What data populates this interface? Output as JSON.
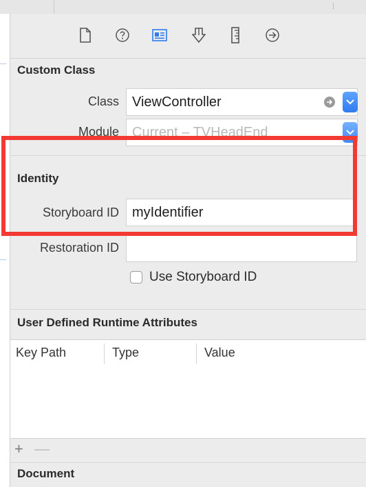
{
  "toolbar": {
    "tabs": [
      {
        "name": "file-inspector",
        "icon": "file-icon"
      },
      {
        "name": "quick-help",
        "icon": "question-circle-icon"
      },
      {
        "name": "identity-inspector",
        "icon": "identity-card-icon",
        "active": true
      },
      {
        "name": "attributes-inspector",
        "icon": "attributes-icon"
      },
      {
        "name": "size-inspector",
        "icon": "ruler-icon"
      },
      {
        "name": "connections-inspector",
        "icon": "arrow-circle-icon"
      }
    ],
    "active_color": "#2f7bef"
  },
  "custom_class": {
    "title": "Custom Class",
    "class_label": "Class",
    "class_value": "ViewController",
    "module_label": "Module",
    "module_value": "Current – TVHeadEnd"
  },
  "identity": {
    "title": "Identity",
    "storyboard_id_label": "Storyboard ID",
    "storyboard_id_value": "myIdentifier",
    "restoration_id_label": "Restoration ID",
    "restoration_id_value": "",
    "use_storyboard_id_label": "Use Storyboard ID",
    "use_storyboard_id_checked": false
  },
  "runtime_attributes": {
    "title": "User Defined Runtime Attributes",
    "columns": [
      "Key Path",
      "Type",
      "Value"
    ],
    "add_label": "+",
    "remove_label": "—"
  },
  "document": {
    "title": "Document"
  },
  "highlight_color": "#f23a33"
}
